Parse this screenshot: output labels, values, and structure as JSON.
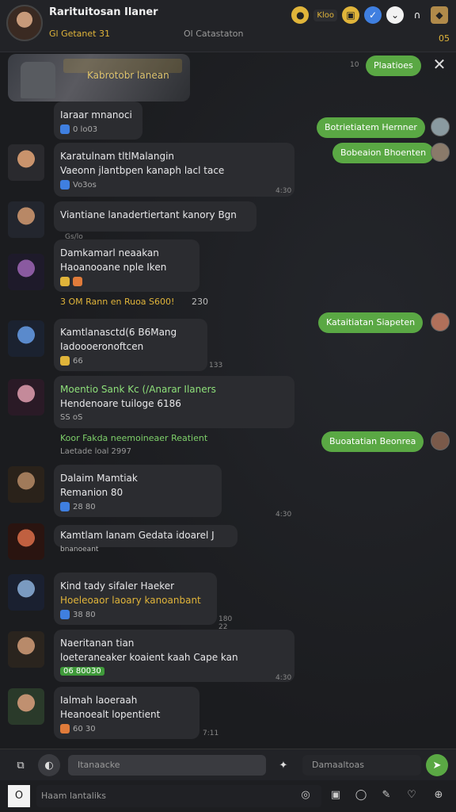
{
  "header": {
    "title": "Rarituitosan Ilaner",
    "subtitle": "Gl Getanet 31",
    "subtitle2": "Ol Catastaton",
    "coins": "Kloo",
    "badge_count": "05"
  },
  "close_label": "✕",
  "messages": [
    {
      "lines": [
        "Kabrotobr lanean"
      ],
      "ts": ""
    },
    {
      "lines": [
        "Iaraar mnanoci"
      ],
      "react": "0 lo03"
    },
    {
      "lines": [
        "Karatulnam tltlMalangin",
        "Vaeonn jlantbpen kanaph lacl tace"
      ],
      "react": "Vo3os",
      "ts": "4:30"
    },
    {
      "lines": [
        "Viantiane lanadertiertant kanory Bgn"
      ],
      "react": "Gs/lo"
    },
    {
      "lines": [
        "Damkamarl neaakan",
        "Haoanooane nple Iken"
      ],
      "react": ""
    },
    {
      "lines": [
        "Kamtlanasctd(6 B6Mang",
        "Iadoooeronoftcen"
      ],
      "react": "66",
      "ts": "133"
    },
    {
      "lines": [
        "Moentio Sank Kc (/Anarar Ilaners",
        "Hendenoare tuiloge 6186"
      ],
      "react": "SS oS"
    },
    {
      "lines": [
        "Dalaim Mamtiak",
        "Remanion 80"
      ],
      "react": "28 80",
      "ts": "4:30"
    },
    {
      "lines": [
        "Kamtlam lanam Gedata idoarel J"
      ],
      "react": "bnanoeant"
    },
    {
      "lines": [
        "Kind tady sifaler Haeker",
        "Hoeleoaor laoary kanoanbant"
      ],
      "react": "38 80",
      "ts": "180 22"
    },
    {
      "lines": [
        "Naeritanan tian",
        "loeteraneaker koaient kaah Cape kan"
      ],
      "react": "06 80030",
      "ts": "4:30"
    },
    {
      "lines": [
        "Ialmah laoeraah",
        "Heanoealt lopentient"
      ],
      "react": "60 30",
      "ts": "7:11"
    }
  ],
  "green": [
    {
      "text": "Plaatioes",
      "ts": "10"
    },
    {
      "text": "Botrietiatem Hernner"
    },
    {
      "text": "Bobeaion Bhoenten"
    },
    {
      "text": "Kataitiatan Siapeten"
    },
    {
      "text": "Buoatatian Beonrea"
    }
  ],
  "system": [
    {
      "text": "3 OM Rann en Ruoa S600!",
      "suffix": "230"
    },
    {
      "text": "Koor Fakda neemoineaer Reatient"
    },
    {
      "text": "Laetade loal 2997"
    }
  ],
  "composer": {
    "placeholder": "Itanaacke",
    "placeholder2": "Damaaltoas"
  },
  "footer": {
    "placeholder": "Haam lantaliks",
    "box": "O"
  },
  "colors": {
    "accent": "#5aa844",
    "bg": "#1b1c1f",
    "bubble": "#2b2c30"
  }
}
